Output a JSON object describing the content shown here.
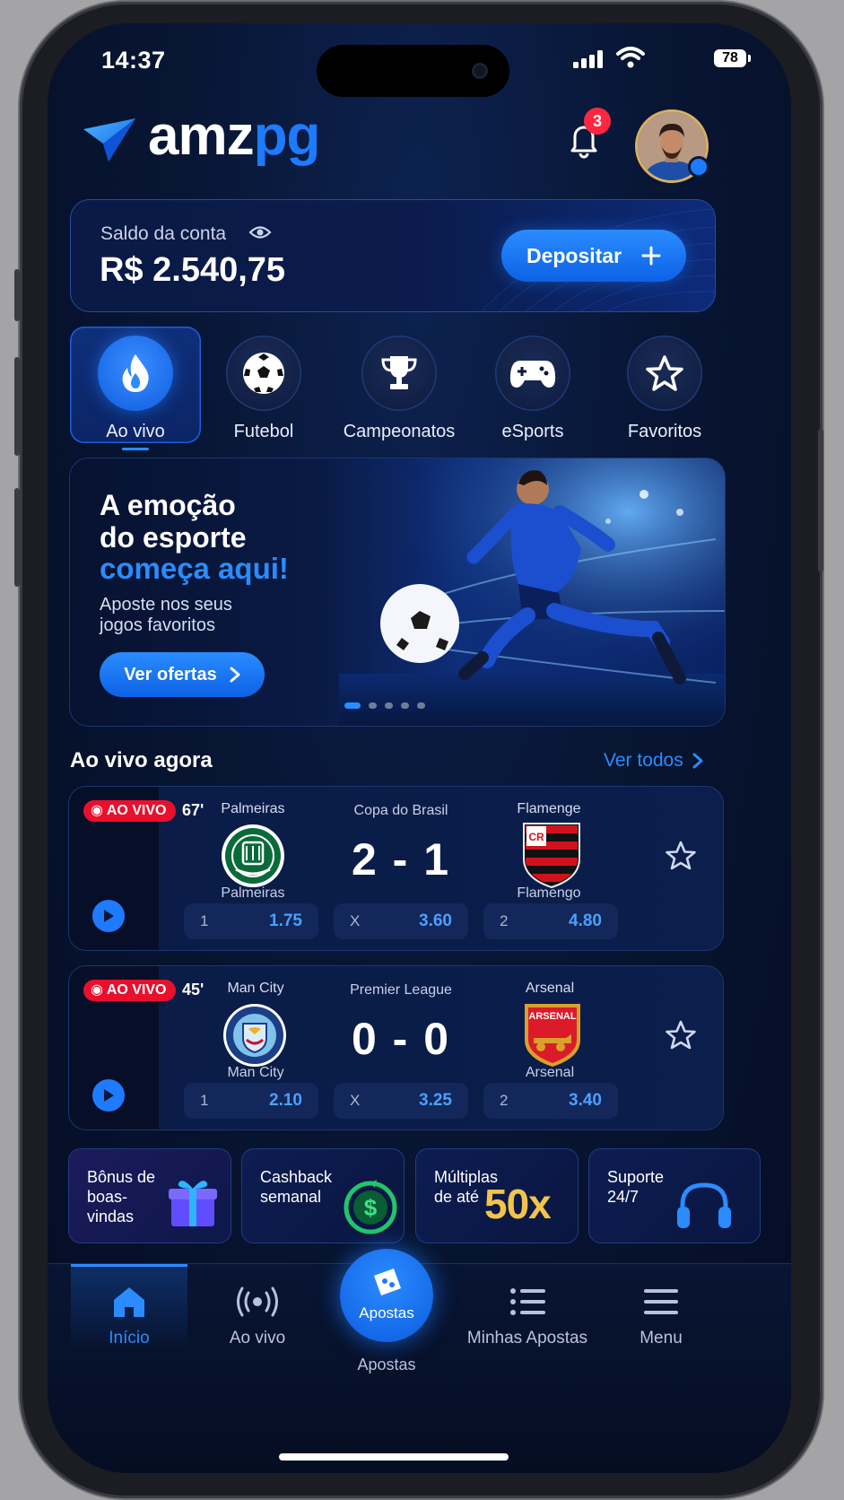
{
  "status_bar": {
    "time": "14:37",
    "battery": "78"
  },
  "header": {
    "logo_part1": "amz",
    "logo_part2": "pg",
    "notification_count": "3"
  },
  "balance": {
    "label": "Saldo da conta",
    "value": "R$ 2.540,75",
    "deposit_label": "Depositar"
  },
  "categories": [
    {
      "label": "Ao vivo",
      "icon": "fire-icon",
      "active": true
    },
    {
      "label": "Futebol",
      "icon": "soccer-ball-icon"
    },
    {
      "label": "Campeonatos",
      "icon": "trophy-icon"
    },
    {
      "label": "eSports",
      "icon": "gamepad-icon"
    },
    {
      "label": "Favoritos",
      "icon": "star-icon"
    }
  ],
  "hero": {
    "title_line1": "A emoção",
    "title_line2": "do esporte",
    "title_highlight": "começa aqui!",
    "subtitle": "Aposte nos seus jogos favoritos",
    "cta": "Ver ofertas"
  },
  "live_section": {
    "title": "Ao vivo agora",
    "see_all": "Ver todos"
  },
  "matches": [
    {
      "badge": "AO VIVO",
      "minute": "67'",
      "league": "Copa do Brasil",
      "home_top": "Palmeiras",
      "home_bottom": "Palmeiras",
      "away_top": "Flamenge",
      "away_bottom": "Flamengo",
      "score": "2 - 1",
      "odds": [
        {
          "key": "1",
          "value": "1.75"
        },
        {
          "key": "X",
          "value": "3.60"
        },
        {
          "key": "2",
          "value": "4.80"
        }
      ]
    },
    {
      "badge": "AO VIVO",
      "minute": "45'",
      "league": "Premier League",
      "home_top": "Man City",
      "home_bottom": "Man City",
      "away_top": "Arsenal",
      "away_bottom": "Arsenal",
      "score": "0 - 0",
      "odds": [
        {
          "key": "1",
          "value": "2.10"
        },
        {
          "key": "X",
          "value": "3.25"
        },
        {
          "key": "2",
          "value": "3.40"
        }
      ]
    }
  ],
  "promos": [
    {
      "text": "Bônus de boas-vindas",
      "icon": "gift-icon"
    },
    {
      "text": "Cashback semanal",
      "icon": "cashback-icon"
    },
    {
      "text": "Múltiplas de até",
      "highlight": "50x",
      "icon": "multiplier-icon"
    },
    {
      "text": "Suporte 24/7",
      "icon": "headset-icon"
    }
  ],
  "bottom_nav": {
    "home": "Início",
    "live": "Ao vivo",
    "bets_fab": "Apostas",
    "bets_sub": "Apostas",
    "my_bets": "Minhas Apostas",
    "menu": "Menu"
  },
  "colors": {
    "accent": "#1e7bff",
    "live": "#e8102d",
    "background": "#081634"
  }
}
